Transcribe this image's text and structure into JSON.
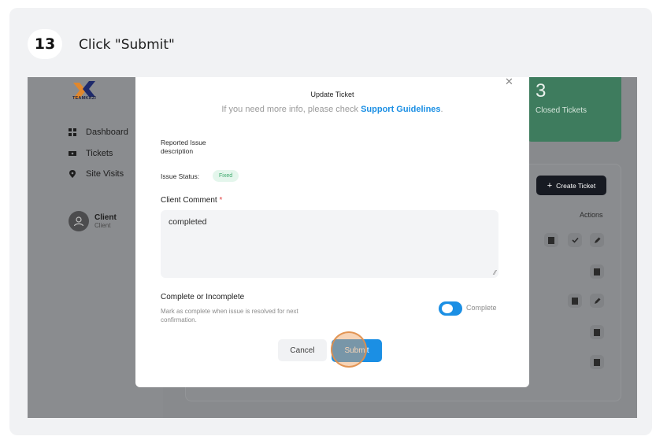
{
  "step": {
    "number": "13",
    "instruction": "Click \"Submit\""
  },
  "app": {
    "logo_text": "TEAMKAZI",
    "sidebar": {
      "items": [
        {
          "label": "Dashboard",
          "icon": "dashboard-icon"
        },
        {
          "label": "Tickets",
          "icon": "ticket-icon"
        },
        {
          "label": "Site Visits",
          "icon": "location-pin-icon"
        }
      ],
      "user": {
        "name": "Client",
        "role": "Client"
      }
    },
    "stat_card": {
      "value": "3",
      "label": "Closed Tickets",
      "color": "#3e7c5e"
    },
    "create_ticket_label": "Create Ticket",
    "actions_header": "Actions"
  },
  "modal": {
    "title": "Update Ticket",
    "subtitle_prefix": "If you need more info, please check ",
    "subtitle_link": "Support Guidelines",
    "subtitle_suffix": ".",
    "reported_issue_label": "Reported Issue",
    "reported_issue_value": "description",
    "issue_status_label": "Issue Status:",
    "issue_status_value": "Fixed",
    "client_comment_label": "Client Comment",
    "required_marker": "*",
    "client_comment_value": "completed",
    "complete_title": "Complete or Incomplete",
    "complete_desc": "Mark as complete when issue is resolved for next confirmation.",
    "toggle_label": "Complete",
    "toggle_on": true,
    "cancel_label": "Cancel",
    "submit_label": "Submit",
    "accent_color": "#1b8fe4"
  }
}
